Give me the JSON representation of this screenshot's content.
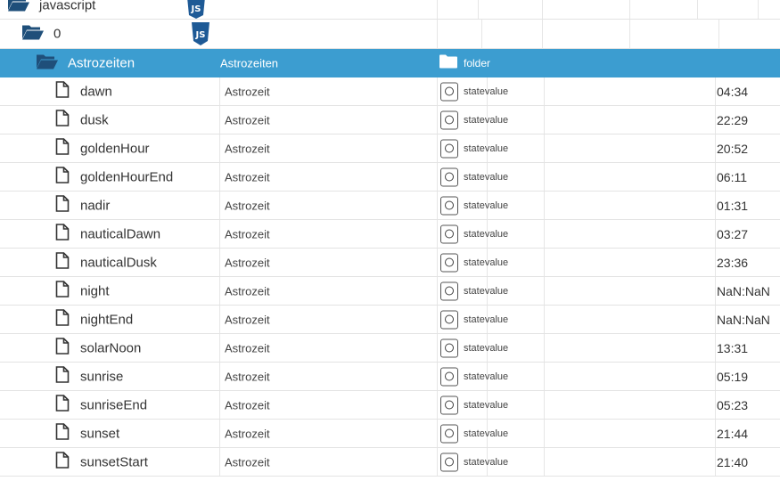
{
  "colors": {
    "selected_bg": "#3c9dd0",
    "js_badge": "#1e5a96",
    "folder_icon": "#1f4f7a"
  },
  "tree": {
    "javascript": {
      "label": "javascript",
      "icon": "folder-open-icon"
    },
    "instance": {
      "label": "0",
      "icon": "folder-open-icon"
    },
    "selected": {
      "label": "Astrozeiten",
      "name": "Astrozeiten",
      "type": "folder"
    }
  },
  "states": [
    {
      "id": "dawn",
      "name": "Astrozeit",
      "role": "statevalue",
      "value": "04:34"
    },
    {
      "id": "dusk",
      "name": "Astrozeit",
      "role": "statevalue",
      "value": "22:29"
    },
    {
      "id": "goldenHour",
      "name": "Astrozeit",
      "role": "statevalue",
      "value": "20:52"
    },
    {
      "id": "goldenHourEnd",
      "name": "Astrozeit",
      "role": "statevalue",
      "value": "06:11"
    },
    {
      "id": "nadir",
      "name": "Astrozeit",
      "role": "statevalue",
      "value": "01:31"
    },
    {
      "id": "nauticalDawn",
      "name": "Astrozeit",
      "role": "statevalue",
      "value": "03:27"
    },
    {
      "id": "nauticalDusk",
      "name": "Astrozeit",
      "role": "statevalue",
      "value": "23:36"
    },
    {
      "id": "night",
      "name": "Astrozeit",
      "role": "statevalue",
      "value": "NaN:NaN"
    },
    {
      "id": "nightEnd",
      "name": "Astrozeit",
      "role": "statevalue",
      "value": "NaN:NaN"
    },
    {
      "id": "solarNoon",
      "name": "Astrozeit",
      "role": "statevalue",
      "value": "13:31"
    },
    {
      "id": "sunrise",
      "name": "Astrozeit",
      "role": "statevalue",
      "value": "05:19"
    },
    {
      "id": "sunriseEnd",
      "name": "Astrozeit",
      "role": "statevalue",
      "value": "05:23"
    },
    {
      "id": "sunset",
      "name": "Astrozeit",
      "role": "statevalue",
      "value": "21:44"
    },
    {
      "id": "sunsetStart",
      "name": "Astrozeit",
      "role": "statevalue",
      "value": "21:40"
    }
  ]
}
